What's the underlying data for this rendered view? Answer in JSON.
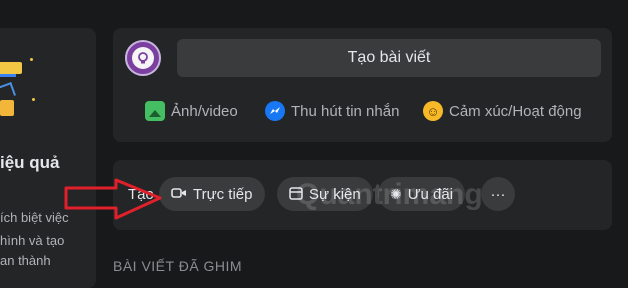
{
  "left_card": {
    "heading": "iệu quả",
    "lines": [
      "ích biệt việc",
      "hình và tạo",
      "an thành"
    ]
  },
  "composer": {
    "create_post_label": "Tạo bài viết",
    "actions": [
      {
        "label": "Ảnh/video",
        "icon": "photo-video-icon"
      },
      {
        "label": "Thu hút tin nhắn",
        "icon": "messenger-icon"
      },
      {
        "label": "Cảm xúc/Hoạt động",
        "icon": "smile-icon"
      }
    ]
  },
  "tools": {
    "label": "Tạo",
    "chips": [
      {
        "label": "Trực tiếp",
        "icon": "live-video-icon"
      },
      {
        "label": "Sự kiện",
        "icon": "calendar-icon"
      },
      {
        "label": "Ưu đãi",
        "icon": "offer-tag-icon"
      },
      {
        "label": "···",
        "icon": "more-icon"
      }
    ]
  },
  "pinned": {
    "heading": "BÀI VIẾT ĐÃ GHIM"
  },
  "watermark": "Quantrimang",
  "colors": {
    "background": "#18191a",
    "card": "#242526",
    "chip": "#3a3b3c",
    "annotation_arrow": "#e0202a",
    "messenger": "#1877f2"
  }
}
